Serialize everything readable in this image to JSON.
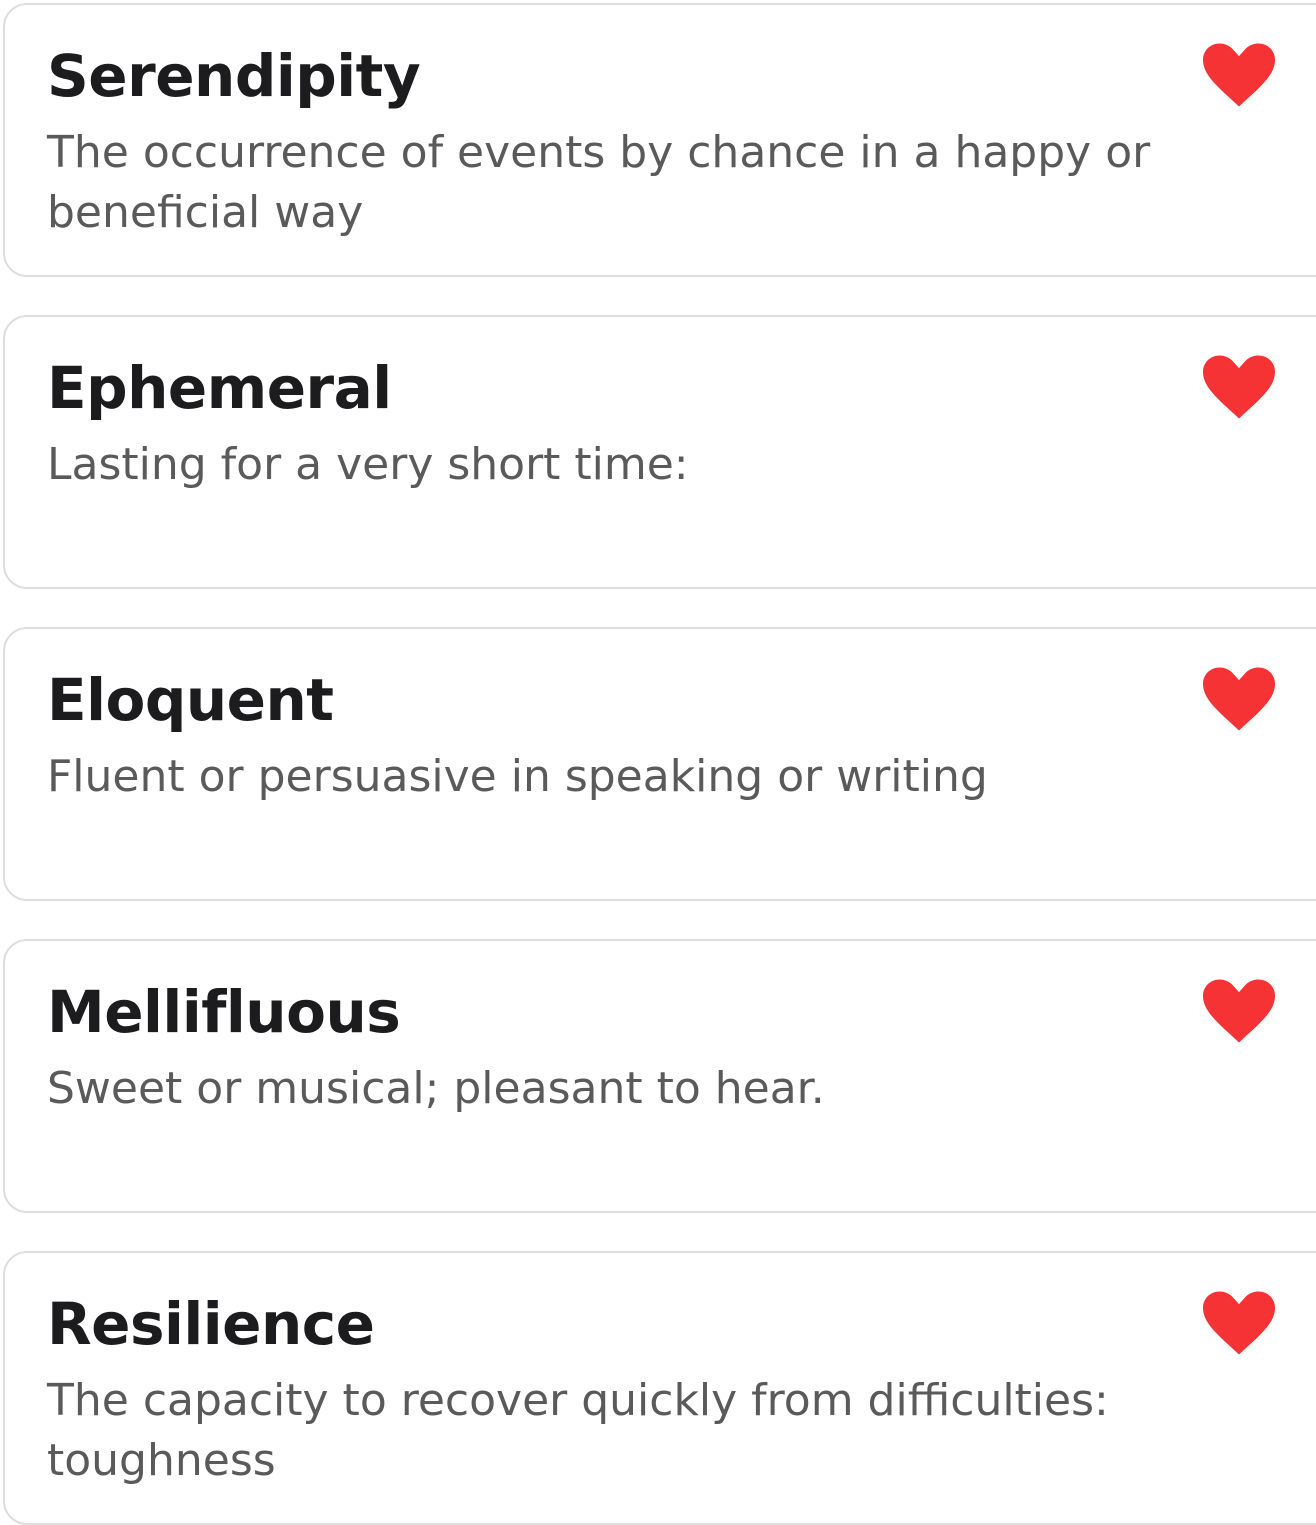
{
  "colors": {
    "heart": "#f53334",
    "word": "#1c1c1e",
    "definition": "#5a5a5a",
    "card_border": "#dedede"
  },
  "words": [
    {
      "word": "Serendipity",
      "definition": "The occurrence of events by chance in a happy or beneficial way",
      "favorite_icon": "heart-filled-icon"
    },
    {
      "word": "Ephemeral",
      "definition": "Lasting for a very short time:",
      "favorite_icon": "heart-filled-icon"
    },
    {
      "word": "Eloquent",
      "definition": "Fluent or persuasive in speaking or writing",
      "favorite_icon": "heart-filled-icon"
    },
    {
      "word": "Mellifluous",
      "definition": "Sweet or musical; pleasant to hear.",
      "favorite_icon": "heart-filled-icon"
    },
    {
      "word": "Resilience",
      "definition": "The capacity to recover quickly from difficulties: toughness",
      "favorite_icon": "heart-filled-icon"
    }
  ]
}
